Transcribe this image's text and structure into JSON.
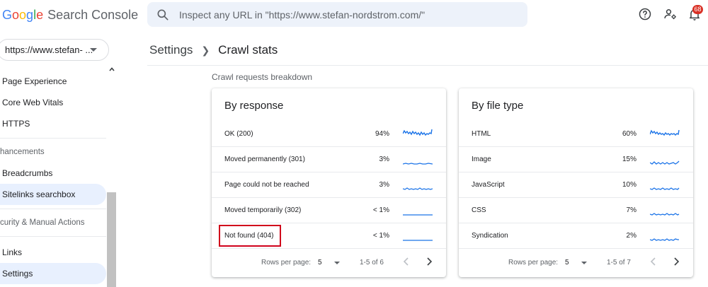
{
  "header": {
    "logo_letters": [
      "G",
      "o",
      "o",
      "g",
      "l",
      "e"
    ],
    "product": "Search Console",
    "search_placeholder": "Inspect any URL in \"https://www.stefan-nordstrom.com/\"",
    "notification_count": "68",
    "icons": [
      "help-icon",
      "manage-accounts-icon",
      "notifications-icon"
    ]
  },
  "sidebar": {
    "property": "https://www.stefan- ...",
    "items": [
      {
        "label": "Page Experience"
      },
      {
        "label": "Core Web Vitals"
      },
      {
        "label": "HTTPS"
      },
      {
        "label": "hancements"
      },
      {
        "label": "Breadcrumbs"
      },
      {
        "label": "Sitelinks searchbox"
      },
      {
        "label": "curity & Manual Actions"
      },
      {
        "label": "Links"
      },
      {
        "label": "Settings"
      }
    ]
  },
  "breadcrumb": {
    "parent": "Settings",
    "current": "Crawl stats"
  },
  "section_label": "Crawl requests breakdown",
  "cards": [
    {
      "title": "By response",
      "rows": [
        {
          "name": "OK (200)",
          "percent": "94%"
        },
        {
          "name": "Moved permanently (301)",
          "percent": "3%"
        },
        {
          "name": "Page could not be reached",
          "percent": "3%"
        },
        {
          "name": "Moved temporarily (302)",
          "percent": "< 1%"
        },
        {
          "name": "Not found (404)",
          "percent": "< 1%"
        }
      ],
      "pager": {
        "rows_label": "Rows per page:",
        "rows_value": "5",
        "range": "1-5 of 6"
      }
    },
    {
      "title": "By file type",
      "rows": [
        {
          "name": "HTML",
          "percent": "60%"
        },
        {
          "name": "Image",
          "percent": "15%"
        },
        {
          "name": "JavaScript",
          "percent": "10%"
        },
        {
          "name": "CSS",
          "percent": "7%"
        },
        {
          "name": "Syndication",
          "percent": "2%"
        }
      ],
      "pager": {
        "rows_label": "Rows per page:",
        "rows_value": "5",
        "range": "1-5 of 7"
      }
    }
  ],
  "colors": {
    "accent": "#1a73e8",
    "sparkline": "#1a73e8",
    "highlight": "#d0021b",
    "active_nav": "#e8f0fe"
  }
}
